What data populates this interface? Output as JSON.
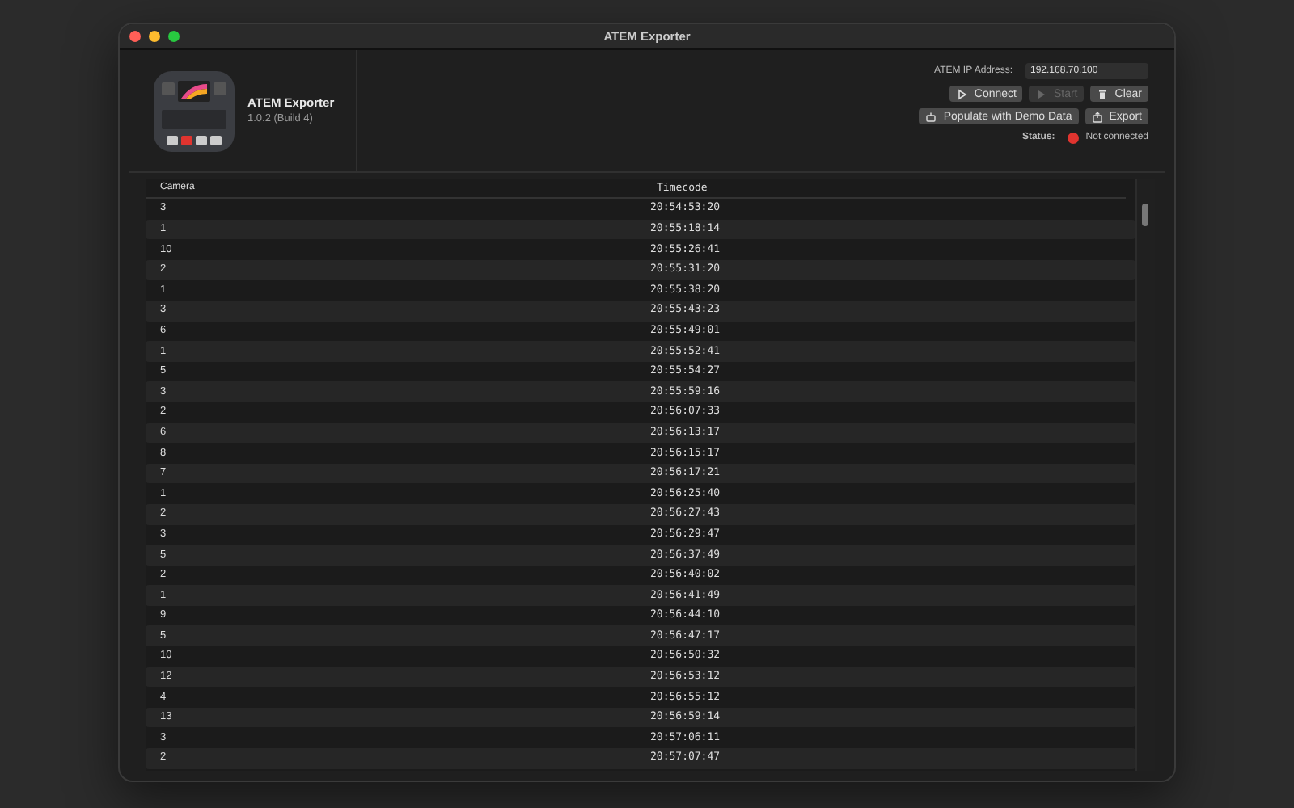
{
  "window": {
    "title": "ATEM Exporter"
  },
  "app": {
    "name": "ATEM Exporter",
    "version": "1.0.2 (Build 4)"
  },
  "ip": {
    "label": "ATEM IP Address:",
    "value": "192.168.70.100"
  },
  "buttons": [
    {
      "label": "Connect",
      "kind": "play",
      "disabled": false
    },
    {
      "label": "Start",
      "kind": "play-filled",
      "disabled": true
    },
    {
      "label": "Clear",
      "kind": "trash",
      "disabled": false
    },
    {
      "label": "Populate with Demo Data",
      "kind": "robot",
      "disabled": false
    },
    {
      "label": "Export",
      "kind": "share",
      "disabled": false
    }
  ],
  "status": {
    "label": "Status:",
    "value": "Not connected",
    "color": "#e0342f"
  },
  "table": {
    "columns": [
      "Camera",
      "Timecode"
    ],
    "rows": [
      [
        "3",
        "20:54:53:20"
      ],
      [
        "1",
        "20:55:18:14"
      ],
      [
        "10",
        "20:55:26:41"
      ],
      [
        "2",
        "20:55:31:20"
      ],
      [
        "1",
        "20:55:38:20"
      ],
      [
        "3",
        "20:55:43:23"
      ],
      [
        "6",
        "20:55:49:01"
      ],
      [
        "1",
        "20:55:52:41"
      ],
      [
        "5",
        "20:55:54:27"
      ],
      [
        "3",
        "20:55:59:16"
      ],
      [
        "2",
        "20:56:07:33"
      ],
      [
        "6",
        "20:56:13:17"
      ],
      [
        "8",
        "20:56:15:17"
      ],
      [
        "7",
        "20:56:17:21"
      ],
      [
        "1",
        "20:56:25:40"
      ],
      [
        "2",
        "20:56:27:43"
      ],
      [
        "3",
        "20:56:29:47"
      ],
      [
        "5",
        "20:56:37:49"
      ],
      [
        "2",
        "20:56:40:02"
      ],
      [
        "1",
        "20:56:41:49"
      ],
      [
        "9",
        "20:56:44:10"
      ],
      [
        "5",
        "20:56:47:17"
      ],
      [
        "10",
        "20:56:50:32"
      ],
      [
        "12",
        "20:56:53:12"
      ],
      [
        "4",
        "20:56:55:12"
      ],
      [
        "13",
        "20:56:59:14"
      ],
      [
        "3",
        "20:57:06:11"
      ],
      [
        "2",
        "20:57:07:47"
      ]
    ]
  }
}
